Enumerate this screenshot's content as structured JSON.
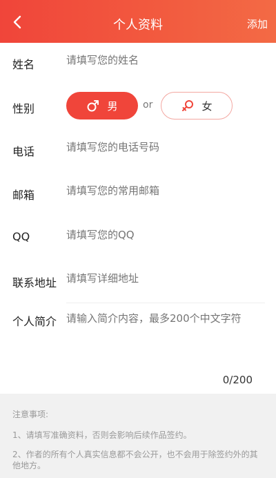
{
  "header": {
    "title": "个人资料",
    "action_label": "添加"
  },
  "form": {
    "name": {
      "label": "姓名",
      "placeholder": "请填写您的姓名"
    },
    "gender": {
      "label": "性别",
      "male": "男",
      "or": "or",
      "female": "女",
      "selected": "male"
    },
    "phone": {
      "label": "电话",
      "placeholder": "请填写您的电话号码"
    },
    "email": {
      "label": "邮箱",
      "placeholder": "请填写您的常用邮箱"
    },
    "qq": {
      "label": "QQ",
      "placeholder": "请填写您的QQ"
    },
    "address": {
      "label": "联系地址",
      "placeholder": "请填写详细地址"
    },
    "bio": {
      "label": "个人简介",
      "placeholder": "请输入简介内容，最多200个中文字符",
      "counter": "0/200"
    }
  },
  "notes": {
    "title": "注意事项:",
    "items": [
      "1、请填写准确资料，否则会影响后续作品签约。",
      "2、作者的所有个人真实信息都不会公开，也不会用于除签约外的其他地方。"
    ]
  },
  "colors": {
    "accent": "#f0453a",
    "header_gradient_end": "#f36a45"
  },
  "icons": {
    "back": "chevron-left-icon",
    "male": "male-symbol-icon",
    "female": "female-symbol-icon"
  }
}
